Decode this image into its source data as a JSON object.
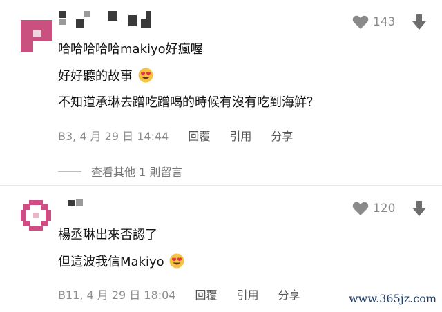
{
  "comments": [
    {
      "likes": "143",
      "lines": [
        "哈哈哈哈哈makiyo好瘋喔",
        "好好聽的故事",
        "不知道承琳去蹭吃蹭喝的時候有沒有吃到海鮮？"
      ],
      "timestamp": "B3, 4 月 29 日 14:44",
      "actions": [
        "回覆",
        "引用",
        "分享"
      ],
      "more_replies": "查看其他 1 則留言"
    },
    {
      "likes": "120",
      "lines": [
        "楊丞琳出來否認了",
        "但這波我信Makiyo"
      ],
      "timestamp": "B11, 4 月 29 日 18:04",
      "actions": [
        "回覆",
        "引用",
        "分享"
      ]
    }
  ],
  "watermark": "www.365jz.com",
  "icons": {
    "like": "heart-icon",
    "dislike": "arrow-down-icon",
    "emoji": "heart-eyes-emoji-icon"
  },
  "colors": {
    "avatar_pink": "#c9507f",
    "meta_gray": "#8c8c8c"
  }
}
